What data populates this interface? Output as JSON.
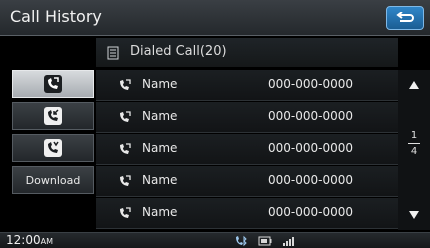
{
  "header": {
    "title": "Call History"
  },
  "subheader": {
    "label": "Dialed Call(20)"
  },
  "left_menu": {
    "items": [
      {
        "icon": "dialed-call-icon",
        "active": true
      },
      {
        "icon": "received-call-icon",
        "active": false
      },
      {
        "icon": "missed-call-icon",
        "active": false
      },
      {
        "label": "Download",
        "active": false
      }
    ]
  },
  "list": {
    "rows": [
      {
        "name": "Name",
        "number": "000-000-0000"
      },
      {
        "name": "Name",
        "number": "000-000-0000"
      },
      {
        "name": "Name",
        "number": "000-000-0000"
      },
      {
        "name": "Name",
        "number": "000-000-0000"
      },
      {
        "name": "Name",
        "number": "000-000-0000"
      }
    ]
  },
  "scroll": {
    "page": "1",
    "total": "4"
  },
  "status": {
    "time": "12:00",
    "ampm": "AM"
  },
  "colors": {
    "accent": "#2f86c9"
  }
}
